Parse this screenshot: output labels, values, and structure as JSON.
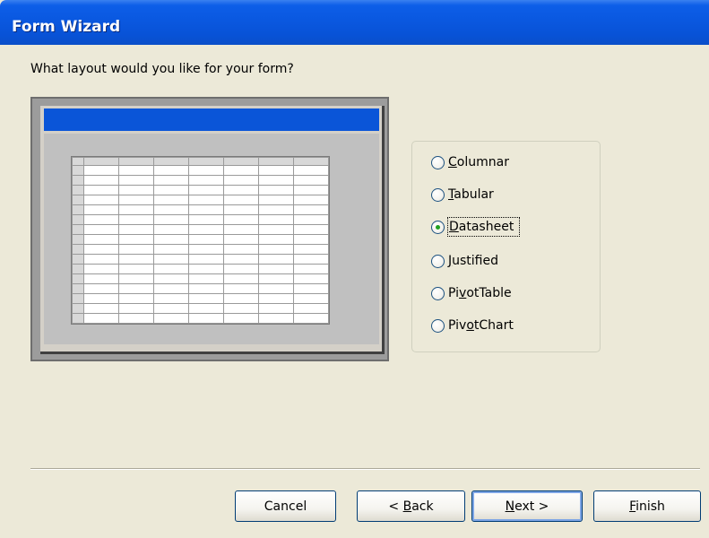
{
  "window": {
    "title": "Form Wizard"
  },
  "prompt": "What layout would you like for your form?",
  "layout_options": {
    "items": [
      {
        "label": "Columnar",
        "underline_index": 0,
        "checked": false
      },
      {
        "label": "Tabular",
        "underline_index": 0,
        "checked": false
      },
      {
        "label": "Datasheet",
        "underline_index": 0,
        "checked": true
      },
      {
        "label": "Justified",
        "underline_index": 0,
        "checked": false
      },
      {
        "label": "PivotTable",
        "underline_index": 2,
        "checked": false
      },
      {
        "label": "PivotChart",
        "underline_index": 3,
        "checked": false
      }
    ]
  },
  "buttons": {
    "cancel": "Cancel",
    "back_prefix": "< ",
    "back_mnemonic": "B",
    "back_rest": "ack",
    "next_mnemonic": "N",
    "next_rest": "ext >",
    "finish_mnemonic": "F",
    "finish_rest": "inish"
  },
  "colors": {
    "titlebar": "#0a58e0",
    "preview_header": "#0a55d8",
    "dialog_bg": "#ece9d8",
    "radio_checked": "#21a121"
  }
}
